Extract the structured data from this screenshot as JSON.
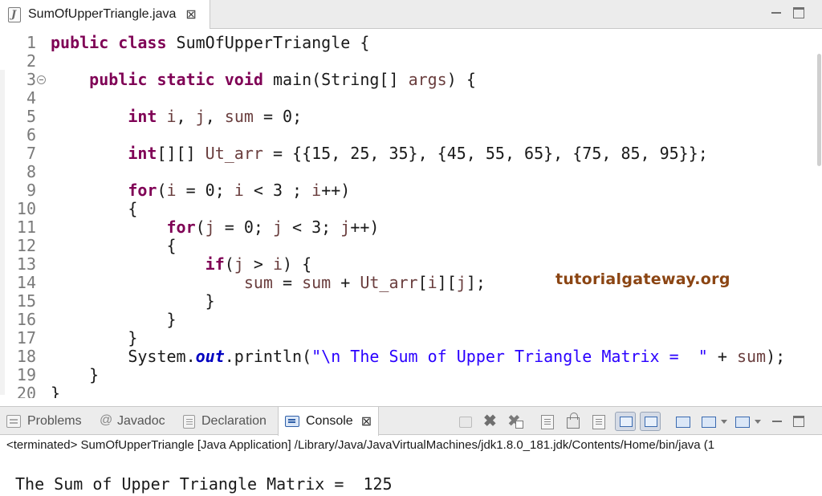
{
  "editor_tab": {
    "title": "SumOfUpperTriangle.java",
    "close_glyph": "⊠",
    "icon": "java-file-icon"
  },
  "code_lines": [
    {
      "ln": "1",
      "segs": [
        [
          "kw",
          "public"
        ],
        [
          "t",
          " "
        ],
        [
          "kw",
          "class"
        ],
        [
          "t",
          " SumOfUpperTriangle {"
        ]
      ]
    },
    {
      "ln": "2",
      "segs": []
    },
    {
      "ln": "3",
      "fold": true,
      "segs": [
        [
          "t",
          "    "
        ],
        [
          "kw",
          "public"
        ],
        [
          "t",
          " "
        ],
        [
          "kw",
          "static"
        ],
        [
          "t",
          " "
        ],
        [
          "kw",
          "void"
        ],
        [
          "t",
          " main(String[] "
        ],
        [
          "var",
          "args"
        ],
        [
          "t",
          ") {"
        ]
      ]
    },
    {
      "ln": "4",
      "segs": []
    },
    {
      "ln": "5",
      "segs": [
        [
          "t",
          "        "
        ],
        [
          "kw",
          "int"
        ],
        [
          "t",
          " "
        ],
        [
          "var",
          "i"
        ],
        [
          "t",
          ", "
        ],
        [
          "var",
          "j"
        ],
        [
          "t",
          ", "
        ],
        [
          "var",
          "sum"
        ],
        [
          "t",
          " = 0;"
        ]
      ]
    },
    {
      "ln": "6",
      "segs": []
    },
    {
      "ln": "7",
      "segs": [
        [
          "t",
          "        "
        ],
        [
          "kw",
          "int"
        ],
        [
          "t",
          "[][] "
        ],
        [
          "var",
          "Ut_arr"
        ],
        [
          "t",
          " = {{15, 25, 35}, {45, 55, 65}, {75, 85, 95}};"
        ]
      ]
    },
    {
      "ln": "8",
      "segs": []
    },
    {
      "ln": "9",
      "segs": [
        [
          "t",
          "        "
        ],
        [
          "kw",
          "for"
        ],
        [
          "t",
          "("
        ],
        [
          "var",
          "i"
        ],
        [
          "t",
          " = 0; "
        ],
        [
          "var",
          "i"
        ],
        [
          "t",
          " < 3 ; "
        ],
        [
          "var",
          "i"
        ],
        [
          "t",
          "++)"
        ]
      ]
    },
    {
      "ln": "10",
      "segs": [
        [
          "t",
          "        {"
        ]
      ]
    },
    {
      "ln": "11",
      "segs": [
        [
          "t",
          "            "
        ],
        [
          "kw",
          "for"
        ],
        [
          "t",
          "("
        ],
        [
          "var",
          "j"
        ],
        [
          "t",
          " = 0; "
        ],
        [
          "var",
          "j"
        ],
        [
          "t",
          " < 3; "
        ],
        [
          "var",
          "j"
        ],
        [
          "t",
          "++)"
        ]
      ]
    },
    {
      "ln": "12",
      "segs": [
        [
          "t",
          "            {"
        ]
      ]
    },
    {
      "ln": "13",
      "segs": [
        [
          "t",
          "                "
        ],
        [
          "kw",
          "if"
        ],
        [
          "t",
          "("
        ],
        [
          "var",
          "j"
        ],
        [
          "t",
          " > "
        ],
        [
          "var",
          "i"
        ],
        [
          "t",
          ") {"
        ]
      ]
    },
    {
      "ln": "14",
      "segs": [
        [
          "t",
          "                    "
        ],
        [
          "var",
          "sum"
        ],
        [
          "t",
          " = "
        ],
        [
          "var",
          "sum"
        ],
        [
          "t",
          " + "
        ],
        [
          "var",
          "Ut_arr"
        ],
        [
          "t",
          "["
        ],
        [
          "var",
          "i"
        ],
        [
          "t",
          "]["
        ],
        [
          "var",
          "j"
        ],
        [
          "t",
          "];"
        ]
      ]
    },
    {
      "ln": "15",
      "segs": [
        [
          "t",
          "                }"
        ]
      ]
    },
    {
      "ln": "16",
      "segs": [
        [
          "t",
          "            }"
        ]
      ]
    },
    {
      "ln": "17",
      "segs": [
        [
          "t",
          "        }"
        ]
      ]
    },
    {
      "ln": "18",
      "segs": [
        [
          "t",
          "        System."
        ],
        [
          "fld",
          "out"
        ],
        [
          "t",
          ".println("
        ],
        [
          "str",
          "\"\\n The Sum of Upper Triangle Matrix =  \""
        ],
        [
          "t",
          " + "
        ],
        [
          "var",
          "sum"
        ],
        [
          "t",
          ");"
        ]
      ]
    },
    {
      "ln": "19",
      "segs": [
        [
          "t",
          "    }"
        ]
      ]
    },
    {
      "ln": "20",
      "segs": [
        [
          "t",
          "}"
        ]
      ]
    }
  ],
  "watermark": "tutorialgateway.org",
  "console_tabs": {
    "problems": "Problems",
    "javadoc": "Javadoc",
    "declaration": "Declaration",
    "console": "Console",
    "close_glyph": "⊠"
  },
  "console": {
    "status": "<terminated> SumOfUpperTriangle [Java Application] /Library/Java/JavaVirtualMachines/jdk1.8.0_181.jdk/Contents/Home/bin/java  (1",
    "output": "The Sum of Upper Triangle Matrix =  125"
  }
}
